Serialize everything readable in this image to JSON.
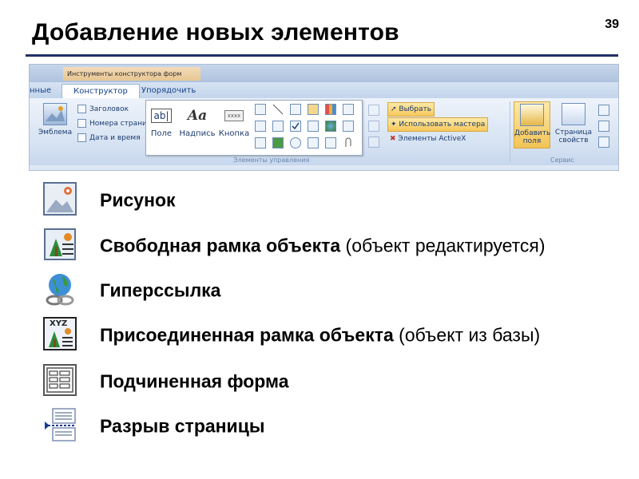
{
  "slide": {
    "title": "Добавление новых элементов",
    "number": "39"
  },
  "ribbon": {
    "context_title": "Инструменты конструктора форм",
    "tabs": [
      "нные",
      "Конструктор",
      "Упорядочить"
    ],
    "logo_group": {
      "emblem_label": "Эмблема"
    },
    "header_items": [
      "Заголовок",
      "Номера страни",
      "Дата и время"
    ],
    "controls": {
      "field_label": "Поле",
      "label_label": "Надпись",
      "button_label": "Кнопка",
      "field_icon_text": "ab|",
      "label_icon_text": "Aa",
      "button_icon_text": "xxxx"
    },
    "tools": [
      "Выбрать",
      "Использовать мастера",
      "Элементы ActiveX"
    ],
    "controls_group_label": "Элементы управления",
    "service": {
      "add_field_label": "Добавить поля",
      "property_sheet_label": "Страница свойств",
      "group_label": "Сервис"
    }
  },
  "items": [
    {
      "icon": "picture-icon",
      "label": "Рисунок",
      "note": ""
    },
    {
      "icon": "unbound-object-frame-icon",
      "label": "Свободная рамка объекта",
      "note": " (объект редактируется)"
    },
    {
      "icon": "hyperlink-icon",
      "label": "Гиперссылка",
      "note": ""
    },
    {
      "icon": "bound-object-frame-icon",
      "label": "Присоединенная рамка объекта",
      "note": " (объект из базы)"
    },
    {
      "icon": "subform-icon",
      "label": "Подчиненная форма",
      "note": ""
    },
    {
      "icon": "page-break-icon",
      "label": "Разрыв страницы",
      "note": ""
    }
  ],
  "colors": {
    "title_rule": "#1f2f66",
    "ribbon_bg": "#dfe8f5",
    "ribbon_text": "#15428b",
    "context_tab": "#e8c692",
    "highlight_button": "#f7c85a"
  }
}
